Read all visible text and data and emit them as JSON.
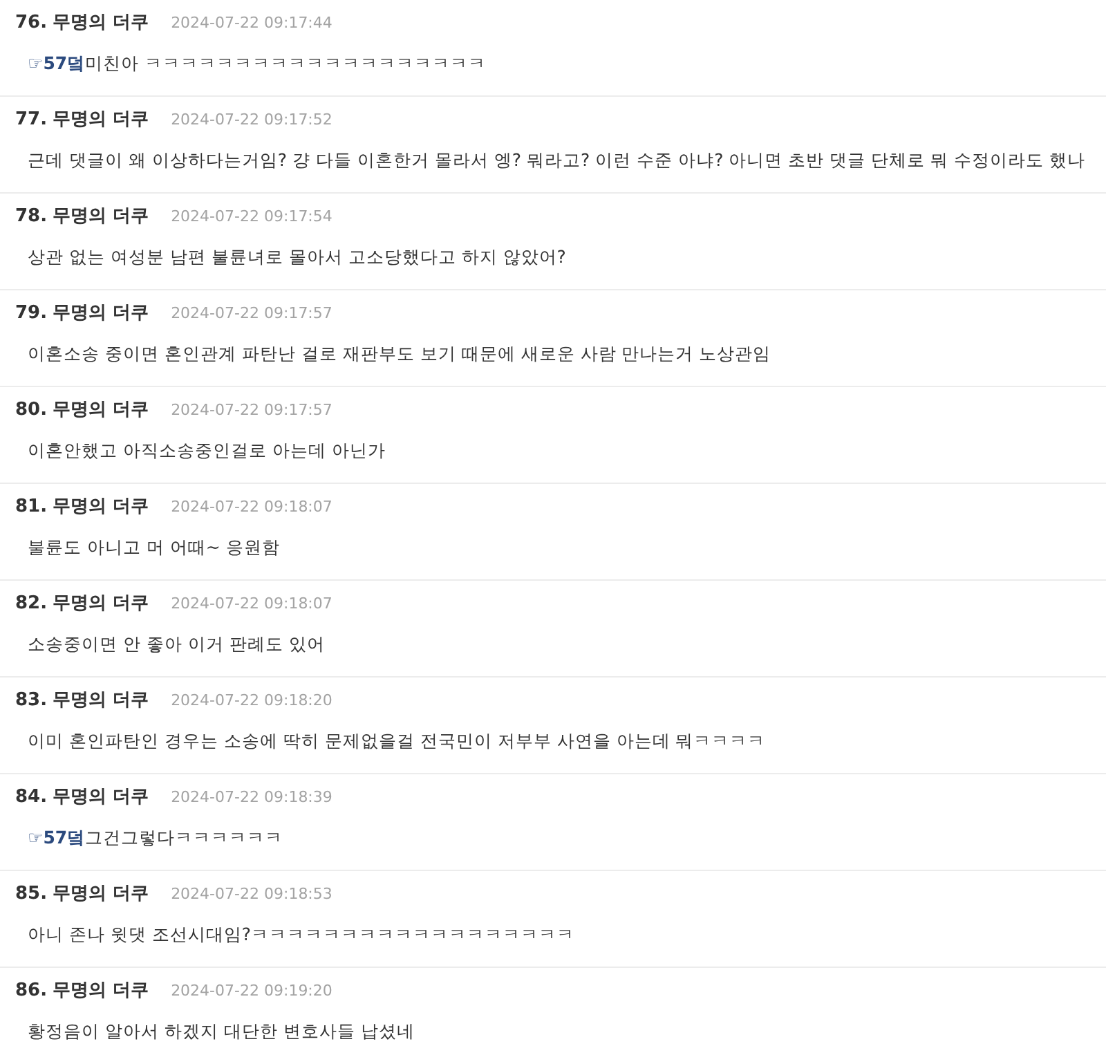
{
  "comments": [
    {
      "number": "76.",
      "author": "무명의 더쿠",
      "time": "2024-07-22 09:17:44",
      "reply_to": "☞57덬",
      "text": "미친아 ㅋㅋㅋㅋㅋㅋㅋㅋㅋㅋㅋㅋㅋㅋㅋㅋㅋㅋㅋ"
    },
    {
      "number": "77.",
      "author": "무명의 더쿠",
      "time": "2024-07-22 09:17:52",
      "text": "근데 댓글이 왜 이상하다는거임? 걍 다들 이혼한거 몰라서 엥? 뭐라고? 이런 수준 아냐? 아니면 초반 댓글 단체로 뭐 수정이라도 했나"
    },
    {
      "number": "78.",
      "author": "무명의 더쿠",
      "time": "2024-07-22 09:17:54",
      "text": "상관 없는 여성분 남편 불륜녀로 몰아서 고소당했다고 하지 않았어?"
    },
    {
      "number": "79.",
      "author": "무명의 더쿠",
      "time": "2024-07-22 09:17:57",
      "text": "이혼소송 중이면 혼인관계 파탄난 걸로 재판부도 보기 때문에 새로운 사람 만나는거 노상관임"
    },
    {
      "number": "80.",
      "author": "무명의 더쿠",
      "time": "2024-07-22 09:17:57",
      "text": "이혼안했고 아직소송중인걸로 아는데 아닌가"
    },
    {
      "number": "81.",
      "author": "무명의 더쿠",
      "time": "2024-07-22 09:18:07",
      "text": "불륜도 아니고 머 어때~ 응원함"
    },
    {
      "number": "82.",
      "author": "무명의 더쿠",
      "time": "2024-07-22 09:18:07",
      "text": "소송중이면 안 좋아 이거 판례도 있어"
    },
    {
      "number": "83.",
      "author": "무명의 더쿠",
      "time": "2024-07-22 09:18:20",
      "text": "이미 혼인파탄인 경우는 소송에 딱히 문제없을걸 전국민이 저부부 사연을 아는데 뭐ㅋㅋㅋㅋ"
    },
    {
      "number": "84.",
      "author": "무명의 더쿠",
      "time": "2024-07-22 09:18:39",
      "reply_to": "☞57덬",
      "text": "그건그렇다ㅋㅋㅋㅋㅋㅋ"
    },
    {
      "number": "85.",
      "author": "무명의 더쿠",
      "time": "2024-07-22 09:18:53",
      "text": "아니 존나 윗댓 조선시대임?ㅋㅋㅋㅋㅋㅋㅋㅋㅋㅋㅋㅋㅋㅋㅋㅋㅋㅋ"
    },
    {
      "number": "86.",
      "author": "무명의 더쿠",
      "time": "2024-07-22 09:19:20",
      "text": "황정음이 알아서 하겠지 대단한 변호사들 납셨네"
    }
  ]
}
